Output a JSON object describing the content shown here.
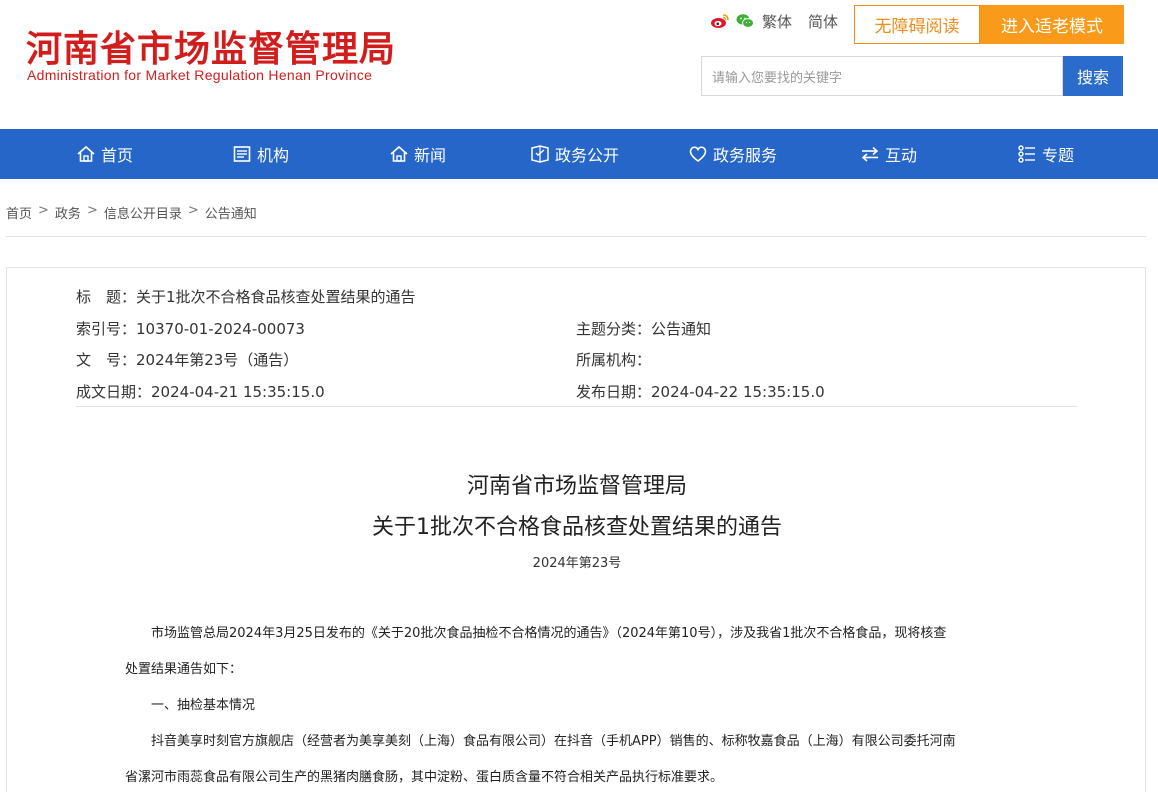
{
  "header": {
    "logo_cn": "河南省市场监督管理局",
    "logo_en": "Administration for Market Regulation Henan Province",
    "lang_traditional": "繁体",
    "lang_simplified": "简体",
    "accessibility_btn": "无障碍阅读",
    "elder_mode_btn": "进入适老模式",
    "search_placeholder": "请输入您要找的关键字",
    "search_btn": "搜索"
  },
  "colors": {
    "brand_red": "#d21d1d",
    "nav_blue": "#2566c8",
    "accent_orange": "#f99a1b"
  },
  "nav": {
    "items": [
      {
        "label": "首页",
        "icon": "home-icon"
      },
      {
        "label": "机构",
        "icon": "org-icon"
      },
      {
        "label": "新闻",
        "icon": "news-icon"
      },
      {
        "label": "政务公开",
        "icon": "open-gov-icon"
      },
      {
        "label": "政务服务",
        "icon": "heart-icon"
      },
      {
        "label": "互动",
        "icon": "exchange-icon"
      },
      {
        "label": "专题",
        "icon": "topic-icon"
      }
    ]
  },
  "breadcrumb": {
    "items": [
      "首页",
      "政务",
      "信息公开目录",
      "公告通知"
    ],
    "sep": ">"
  },
  "meta": {
    "title_label": "标　题：",
    "title_value": "关于1批次不合格食品核查处置结果的通告",
    "index_label": "索引号：",
    "index_value": "10370-01-2024-00073",
    "topic_label": "主题分类：",
    "topic_value": "公告通知",
    "docno_label": "文　号：",
    "docno_value": "2024年第23号（通告）",
    "org_label": "所属机构：",
    "org_value": "",
    "created_label": "成文日期：",
    "created_value": "2024-04-21 15:35:15.0",
    "published_label": "发布日期：",
    "published_value": "2024-04-22 15:35:15.0"
  },
  "article": {
    "heading1": "河南省市场监督管理局",
    "heading2": "关于1批次不合格食品核查处置结果的通告",
    "doc_number": "2024年第23号",
    "p1_line1": "　　市场监管总局2024年3月25日发布的《关于20批次食品抽检不合格情况的通告》（2024年第10号），涉及我省1批次不合格食品，现将核查",
    "p1_line2": "处置结果通告如下：",
    "section1": "　　一、抽检基本情况",
    "p2_line1": "　　抖音美享时刻官方旗舰店（经营者为美享美刻（上海）食品有限公司）在抖音（手机APP）销售的、标称牧嘉食品（上海）有限公司委托河南",
    "p2_line2": "省漯河市雨蕊食品有限公司生产的黑猪肉膳食肠，其中淀粉、蛋白质含量不符合相关产品执行标准要求。"
  }
}
